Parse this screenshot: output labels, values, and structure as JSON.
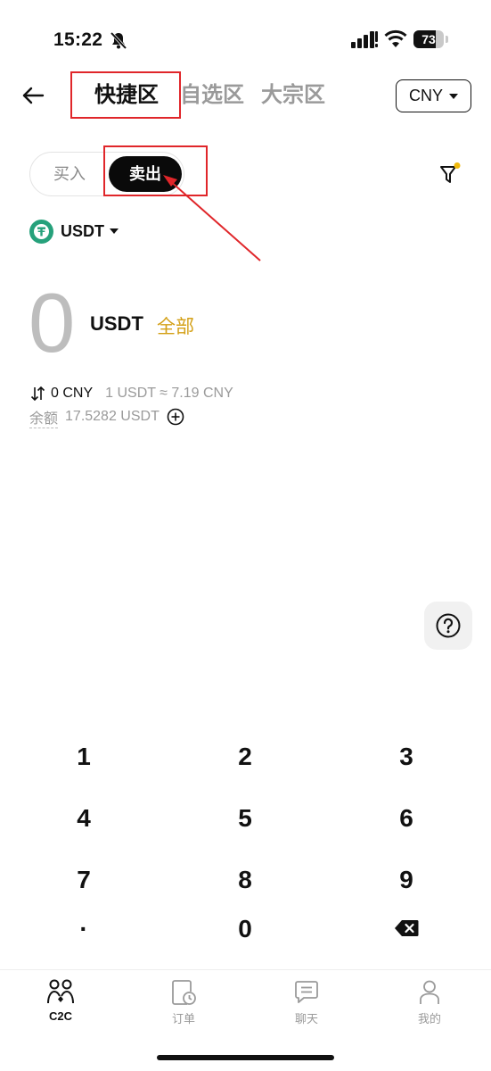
{
  "status_bar": {
    "time": "15:22",
    "battery": "73",
    "battery_level": 0.73
  },
  "header": {
    "tabs": [
      {
        "label": "快捷区",
        "active": true
      },
      {
        "label": "自选区",
        "active": false
      },
      {
        "label": "大宗区",
        "active": false
      }
    ],
    "currency": "CNY"
  },
  "toggle": {
    "buy_label": "买入",
    "sell_label": "卖出",
    "selected": "卖出"
  },
  "coin": {
    "symbol": "USDT"
  },
  "amount": {
    "value": "0",
    "unit": "USDT",
    "all_label": "全部",
    "converted": "0 CNY",
    "rate": "1 USDT ≈ 7.19 CNY",
    "balance_label": "余额",
    "balance_value": "17.5282 USDT"
  },
  "keypad": {
    "keys": [
      "1",
      "2",
      "3",
      "4",
      "5",
      "6",
      "7",
      "8",
      "9",
      "·",
      "0"
    ]
  },
  "bottom_nav": {
    "items": [
      {
        "label": "C2C",
        "icon": "people-icon",
        "active": true
      },
      {
        "label": "订单",
        "icon": "order-clock-icon",
        "active": false
      },
      {
        "label": "聊天",
        "icon": "chat-icon",
        "active": false
      },
      {
        "label": "我的",
        "icon": "person-icon",
        "active": false
      }
    ]
  },
  "colors": {
    "accent_gold": "#d4a017",
    "annotation_red": "#e0262a",
    "tether_green": "#26a17b"
  }
}
